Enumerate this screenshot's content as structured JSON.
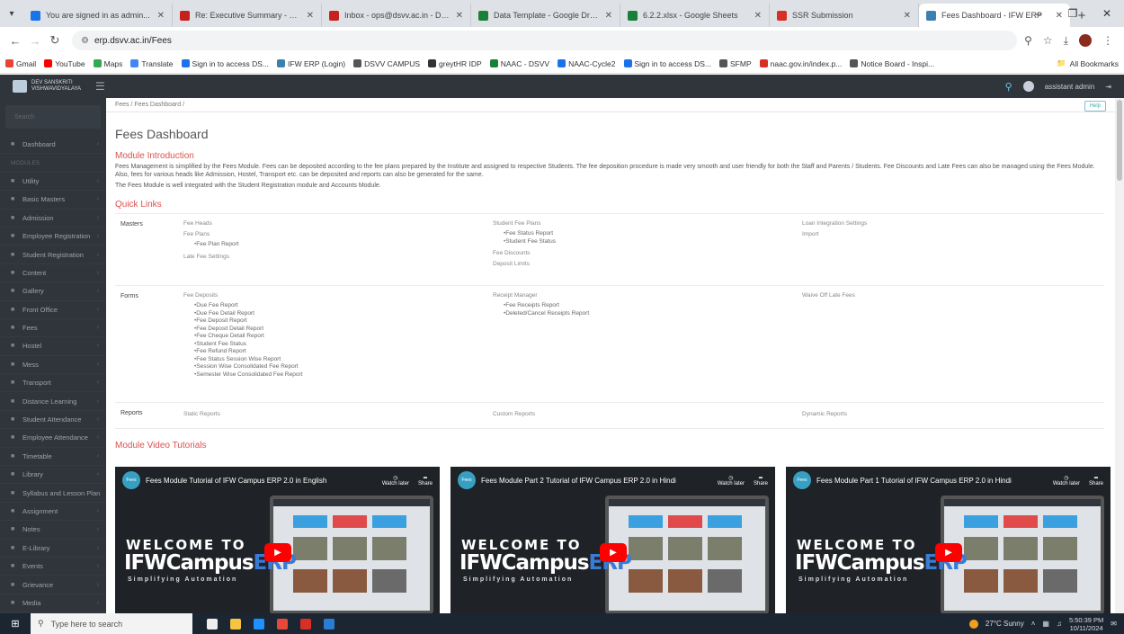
{
  "browser": {
    "tabs": [
      {
        "title": "You are signed in as admin...",
        "icon_color": "#1a73e8"
      },
      {
        "title": "Re: Executive Summary - adhvi...",
        "icon_color": "#c5221f"
      },
      {
        "title": "Inbox - ops@dsvv.ac.in - Dev...",
        "icon_color": "#c5221f"
      },
      {
        "title": "Data Template - Google Drive",
        "icon_color": "#188038"
      },
      {
        "title": "6.2.2.xlsx - Google Sheets",
        "icon_color": "#188038"
      },
      {
        "title": "SSR Submission",
        "icon_color": "#d93025"
      },
      {
        "title": "Fees Dashboard - IFW ERP",
        "icon_color": "#3c7fb1"
      }
    ],
    "url": "erp.dsvv.ac.in/Fees",
    "bookmarks": [
      "Gmail",
      "YouTube",
      "Maps",
      "Translate",
      "Sign in to access DS...",
      "IFW ERP (Login)",
      "DSVV CAMPUS",
      "greytHR IDP",
      "NAAC - DSVV",
      "NAAC-Cycle2",
      "Sign in to access DS...",
      "SFMP",
      "naac.gov.in/index.p...",
      "Notice Board - Inspi..."
    ],
    "all_bookmarks": "All Bookmarks"
  },
  "app": {
    "brand_line1": "DEV SANSKRITI",
    "brand_line2": "VISHWAVIDYALAYA",
    "user": "assistant admin",
    "sidebar": [
      {
        "label": "Search",
        "head": true
      },
      {
        "label": "Dashboard"
      },
      {
        "label": "MODULES",
        "head": true
      },
      {
        "label": "Utility"
      },
      {
        "label": "Basic Masters"
      },
      {
        "label": "Admission"
      },
      {
        "label": "Employee Registration"
      },
      {
        "label": "Student Registration"
      },
      {
        "label": "Content"
      },
      {
        "label": "Gallery"
      },
      {
        "label": "Front Office"
      },
      {
        "label": "Fees"
      },
      {
        "label": "Hostel"
      },
      {
        "label": "Mess"
      },
      {
        "label": "Transport"
      },
      {
        "label": "Distance Learning"
      },
      {
        "label": "Student Attendance"
      },
      {
        "label": "Employee Attendance"
      },
      {
        "label": "Timetable"
      },
      {
        "label": "Library"
      },
      {
        "label": "Syllabus and Lesson Plan"
      },
      {
        "label": "Assignment"
      },
      {
        "label": "Notes"
      },
      {
        "label": "E-Library"
      },
      {
        "label": "Events"
      },
      {
        "label": "Grievance"
      },
      {
        "label": "Media"
      }
    ],
    "breadcrumb": "Fees / Fees Dashboard /",
    "help": "Help",
    "page_title": "Fees Dashboard",
    "module_intro_heading": "Module Introduction",
    "intro_p1": "Fees Management is simplified by the Fees Module. Fees can be deposited according to the fee plans prepared by the Institute and assigned to respective Students. The fee deposition procedure is made very smooth and user friendly for both the Staff and Parents / Students. Fee Discounts and Late Fees can also be managed using the Fees Module. Also, fees for various heads like Admission, Hostel, Transport etc. can be deposited and reports can also be generated for the same.",
    "intro_p2": "The Fees Module is well integrated with the Student Registration module and Accounts Module.",
    "quick_links_heading": "Quick Links",
    "masters_label": "Masters",
    "masters_col1_head": "Fee Heads",
    "masters_col1_sub": "Fee Plans",
    "masters_col1_items": [
      "Fee Plan Report"
    ],
    "masters_col1_after": "Late Fee Settings",
    "masters_col2_head": "Student Fee Plans",
    "masters_col2_items": [
      "Fee Status Report",
      "Student Fee Status"
    ],
    "masters_col2_after1": "Fee Discounts",
    "masters_col2_after2": "Deposit Limits",
    "masters_col3_head": "Loan Integration Settings",
    "masters_col3_after": "Import",
    "forms_label": "Forms",
    "forms_col1_head": "Fee Deposits",
    "forms_col1_items": [
      "Due Fee Report",
      "Due Fee Detail Report",
      "Fee Deposit Report",
      "Fee Deposit Detail Report",
      "Fee Cheque Detail Report",
      "Student Fee Status",
      "Fee Refund Report",
      "Fee Status Session Wise Report",
      "Session Wise Consolidated Fee Report",
      "Semester Wise Consolidated Fee Report"
    ],
    "forms_col2_head": "Receipt Manager",
    "forms_col2_items": [
      "Fee Receipts Report",
      "Deleted/Cancel Receipts Report"
    ],
    "forms_col3_head": "Waive Off Late Fees",
    "reports_label": "Reports",
    "reports_col1": "Static Reports",
    "reports_col2": "Custom Reports",
    "reports_col3": "Dynamic Reports",
    "video_heading": "Module Video Tutorials",
    "videos": [
      {
        "title": "Fees Module Tutorial of IFW Campus ERP 2.0 in English"
      },
      {
        "title": "Fees Module Part 2 Tutorial of IFW Campus ERP 2.0 in Hindi"
      },
      {
        "title": "Fees Module Part 1 Tutorial of IFW Campus ERP 2.0 in Hindi"
      }
    ],
    "video_watch_later": "Watch later",
    "video_share": "Share",
    "video_welcome": "WELCOME TO",
    "video_brand_a": "IFWCampus",
    "video_brand_b": "ERP",
    "video_slogan": "Simplifying Automation",
    "channel_badge": "Fees"
  },
  "taskbar": {
    "search_placeholder": "Type here to search",
    "weather": "27°C Sunny",
    "time": "5:50:39 PM",
    "date": "10/11/2024"
  }
}
